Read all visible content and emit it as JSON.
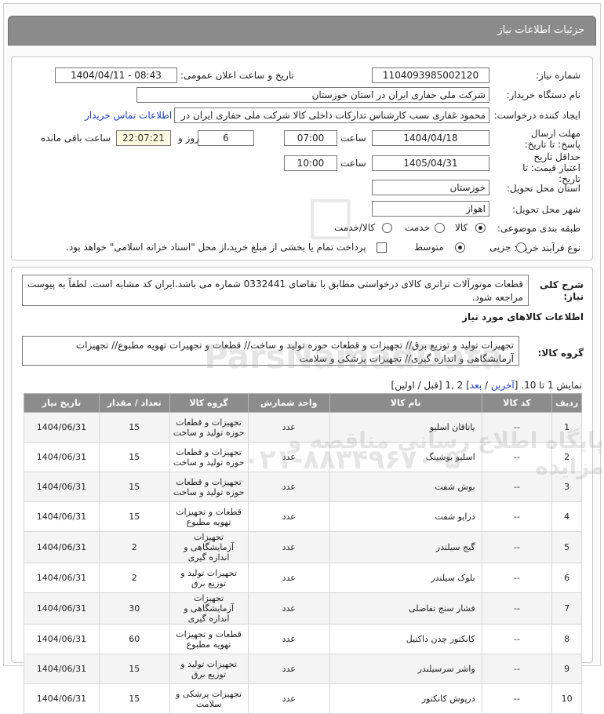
{
  "header": {
    "title": "جزئیات اطلاعات نیاز"
  },
  "form": {
    "need_number_label": "شماره نیاز:",
    "need_number": "1104093985002120",
    "announce_label": "تاریخ و ساعت اعلان عمومی:",
    "announce_value": "1404/04/11 - 08:43",
    "buyer_label": "نام دستگاه خریدار:",
    "buyer_value": "شرکت ملی حفاری ایران در استان خوزستان",
    "requester_label": "ایجاد کننده درخواست:",
    "requester_value": "محمود غفاری نسب کارشناس تدارکات داخلی  کالا شرکت ملی حفاری ایران در",
    "contact_link": "اطلاعات تماس خریدار",
    "deadline_label": "مهلت ارسال پاسخ: تا تاریخ:",
    "deadline_date": "1404/04/18",
    "time_label": "ساعت",
    "deadline_time": "07:00",
    "days_value": "6",
    "days_label": "روز و",
    "remaining_time": "22:07:21",
    "remaining_label": "ساعت باقی مانده",
    "validity_label": "حداقل تاریخ اعتبار قیمت: تا تاریخ:",
    "validity_date": "1405/04/31",
    "validity_time": "10:00",
    "province_label": "استان محل تحویل:",
    "province_value": "خوزستان",
    "city_label": "شهر محل تحویل:",
    "city_value": "اهواز",
    "category_label": "طبقه بندی موضوعی:",
    "category_options": [
      "کالا",
      "خدمت",
      "کالا/خدمت"
    ],
    "category_selected": "کالا",
    "process_label": "نوع فرآیند خرید :",
    "process_options": [
      "جزیی",
      "متوسط"
    ],
    "process_selected": "متوسط",
    "payment_note": "پرداخت تمام یا بخشی از مبلغ خرید،از محل \"اسناد خزانه اسلامی\" خواهد بود."
  },
  "description": {
    "label": "شرح کلی نیاز:",
    "text": "قطعات موتورآلات تراتری کالای درخواستی مطابق با تقاضای 0332441 شماره می باشد.ایران کد مشابه است. لطفاً به پیوست مراجعه شود.",
    "items_title": "اطلاعات کالاهای مورد نیاز",
    "group_label": "گروه کالا:",
    "group_text": "تجهیزات تولید و توزیع برق// تجهیزات و قطعات حوزه تولید و ساخت// قطعات و تجهیزات تهویه مطبوع// تجهیزات آزمایشگاهی و اندازه گیری// تجهیزات پزشکی و سلامت"
  },
  "pagination": {
    "text": "نمایش 1 تا 10. [",
    "last": "آخرین",
    "sep1": " / ",
    "next": "بعد",
    "pages": "] 2 ,1 [قبل / اولین]"
  },
  "table": {
    "headers": [
      "ردیف",
      "کد کالا",
      "نام کالا",
      "واحد شمارش",
      "گروه کالا",
      "تعداد / مقدار",
      "تاریخ نیاز"
    ],
    "rows": [
      [
        "1",
        "--",
        "یاتاقان اسلیو",
        "عدد",
        "تجهیزات و قطعات حوزه تولید و ساخت",
        "15",
        "1404/06/31"
      ],
      [
        "2",
        "--",
        "اسلیو بوشینگ",
        "عدد",
        "تجهیزات و قطعات حوزه تولید و ساخت",
        "15",
        "1404/06/31"
      ],
      [
        "3",
        "--",
        "بوش شفت",
        "عدد",
        "تجهیزات و قطعات حوزه تولید و ساخت",
        "15",
        "1404/06/31"
      ],
      [
        "4",
        "--",
        "درایو شفت",
        "عدد",
        "قطعات و تجهیزات تهویه مطبوع",
        "15",
        "1404/06/31"
      ],
      [
        "5",
        "--",
        "گیج سیلندر",
        "عدد",
        "تجهیزات آزمایشگاهی و اندازه گیری",
        "2",
        "1404/06/31"
      ],
      [
        "6",
        "--",
        "بلوک سیلندر",
        "عدد",
        "تجهیزات تولید و توزیع برق",
        "2",
        "1404/06/31"
      ],
      [
        "7",
        "--",
        "فشار سنج تفاضلی",
        "عدد",
        "تجهیزات آزمایشگاهی و اندازه گیری",
        "30",
        "1404/06/31"
      ],
      [
        "8",
        "--",
        "کانکتور چدن داکتیل",
        "عدد",
        "قطعات و تجهیزات تهویه مطبوع",
        "60",
        "1404/06/31"
      ],
      [
        "9",
        "--",
        "واشر سرسیلندر",
        "عدد",
        "تجهیزات تولید و توزیع برق",
        "15",
        "1404/06/31"
      ],
      [
        "10",
        "--",
        "درپوش کانکتور",
        "عدد",
        "تجهیزات پزشکی و سلامت",
        "15",
        "1404/06/31"
      ]
    ]
  },
  "watermark": {
    "brand": "ParsNamadData",
    "phone": "۰۲۱-۸۸۳۴۹۶۷۰-۵",
    "slogan": "پایگاه اطلاع رسانی مناقصه و مزایده"
  }
}
